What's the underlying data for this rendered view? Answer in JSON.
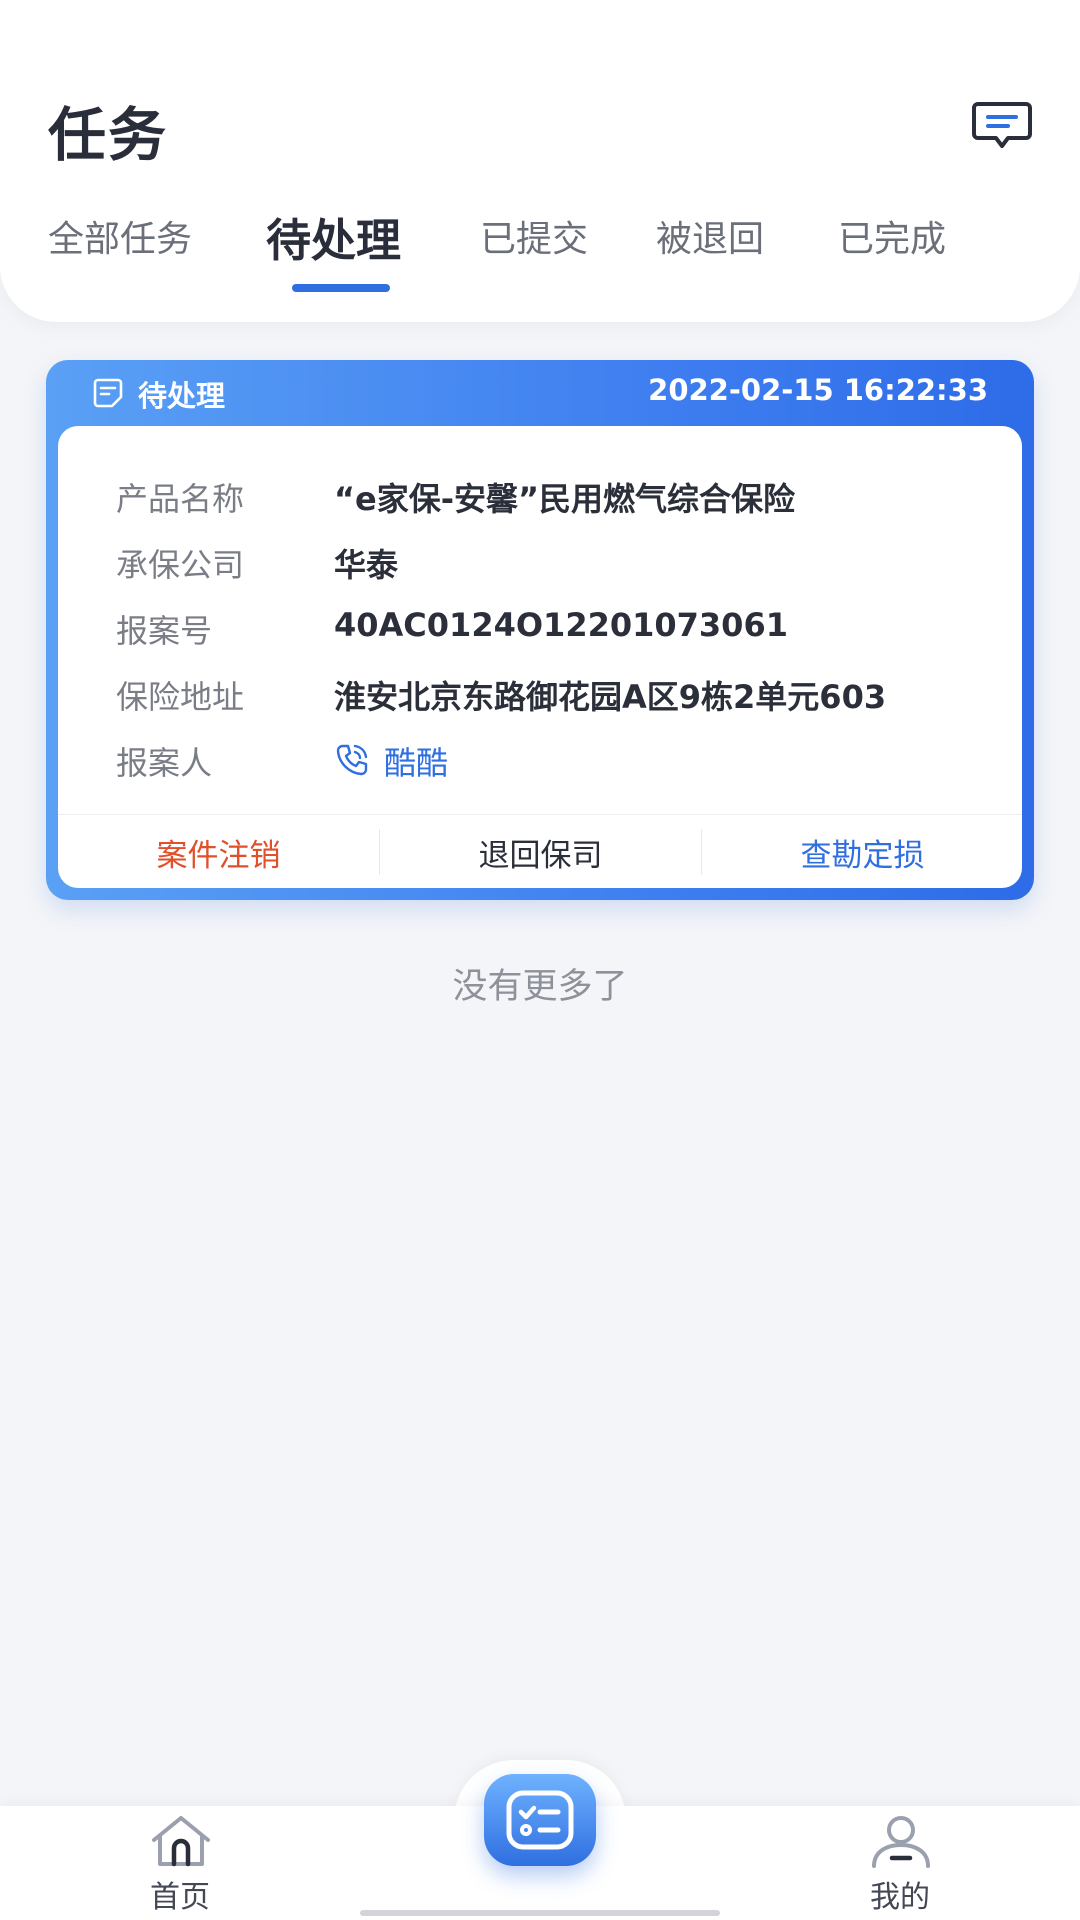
{
  "header": {
    "title": "任务",
    "message_icon": "message-icon"
  },
  "tabs": [
    {
      "label": "全部任务",
      "active": false
    },
    {
      "label": "待处理",
      "active": true
    },
    {
      "label": "已提交",
      "active": false
    },
    {
      "label": "被退回",
      "active": false
    },
    {
      "label": "已完成",
      "active": false
    }
  ],
  "task_card": {
    "status": "待处理",
    "timestamp": "2022-02-15 16:22:33",
    "fields": [
      {
        "label": "产品名称",
        "value": "“e家保-安馨”民用燃气综合保险"
      },
      {
        "label": "承保公司",
        "value": "华泰"
      },
      {
        "label": "报案号",
        "value": "40AC0124O12201073061"
      },
      {
        "label": "保险地址",
        "value": "淮安北京东路御花园A区9栋2单元603"
      },
      {
        "label": "报案人",
        "value": "酷酷"
      }
    ],
    "actions": [
      {
        "label": "案件注销",
        "color": "#e0502a"
      },
      {
        "label": "退回保司",
        "color": "#2b2f3a"
      },
      {
        "label": "查勘定损",
        "color": "#2f6fe0"
      }
    ]
  },
  "list_end_text": "没有更多了",
  "bottom_nav": {
    "home_label": "首页",
    "mine_label": "我的",
    "center_icon": "task-list-icon"
  },
  "colors": {
    "accent": "#2f6fe0",
    "danger": "#e0502a",
    "background": "#f4f5f8"
  }
}
